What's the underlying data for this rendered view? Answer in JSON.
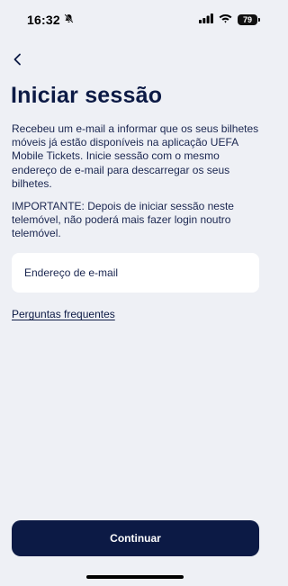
{
  "status_bar": {
    "time": "16:32",
    "battery": "79",
    "icons": [
      "bell-slash-icon",
      "signal-icon",
      "wifi-icon",
      "battery-icon"
    ]
  },
  "nav": {
    "back_icon": "chevron-left-icon"
  },
  "page": {
    "title": "Iniciar sessão",
    "paragraph1": "Recebeu um e-mail a informar que os seus bilhetes móveis já estão disponíveis na aplicação UEFA Mobile Tickets. Inicie sessão com o mesmo endereço de e-mail para descarregar os seus bilhetes.",
    "paragraph2": "IMPORTANTE: Depois de iniciar sessão neste telemóvel, não poderá mais fazer login noutro telemóvel."
  },
  "form": {
    "email_placeholder": "Endereço de e-mail",
    "email_value": ""
  },
  "links": {
    "faq": "Perguntas frequentes"
  },
  "actions": {
    "continue": "Continuar"
  },
  "colors": {
    "background": "#eef0f5",
    "primary": "#0c1a45",
    "field": "#ffffff"
  }
}
